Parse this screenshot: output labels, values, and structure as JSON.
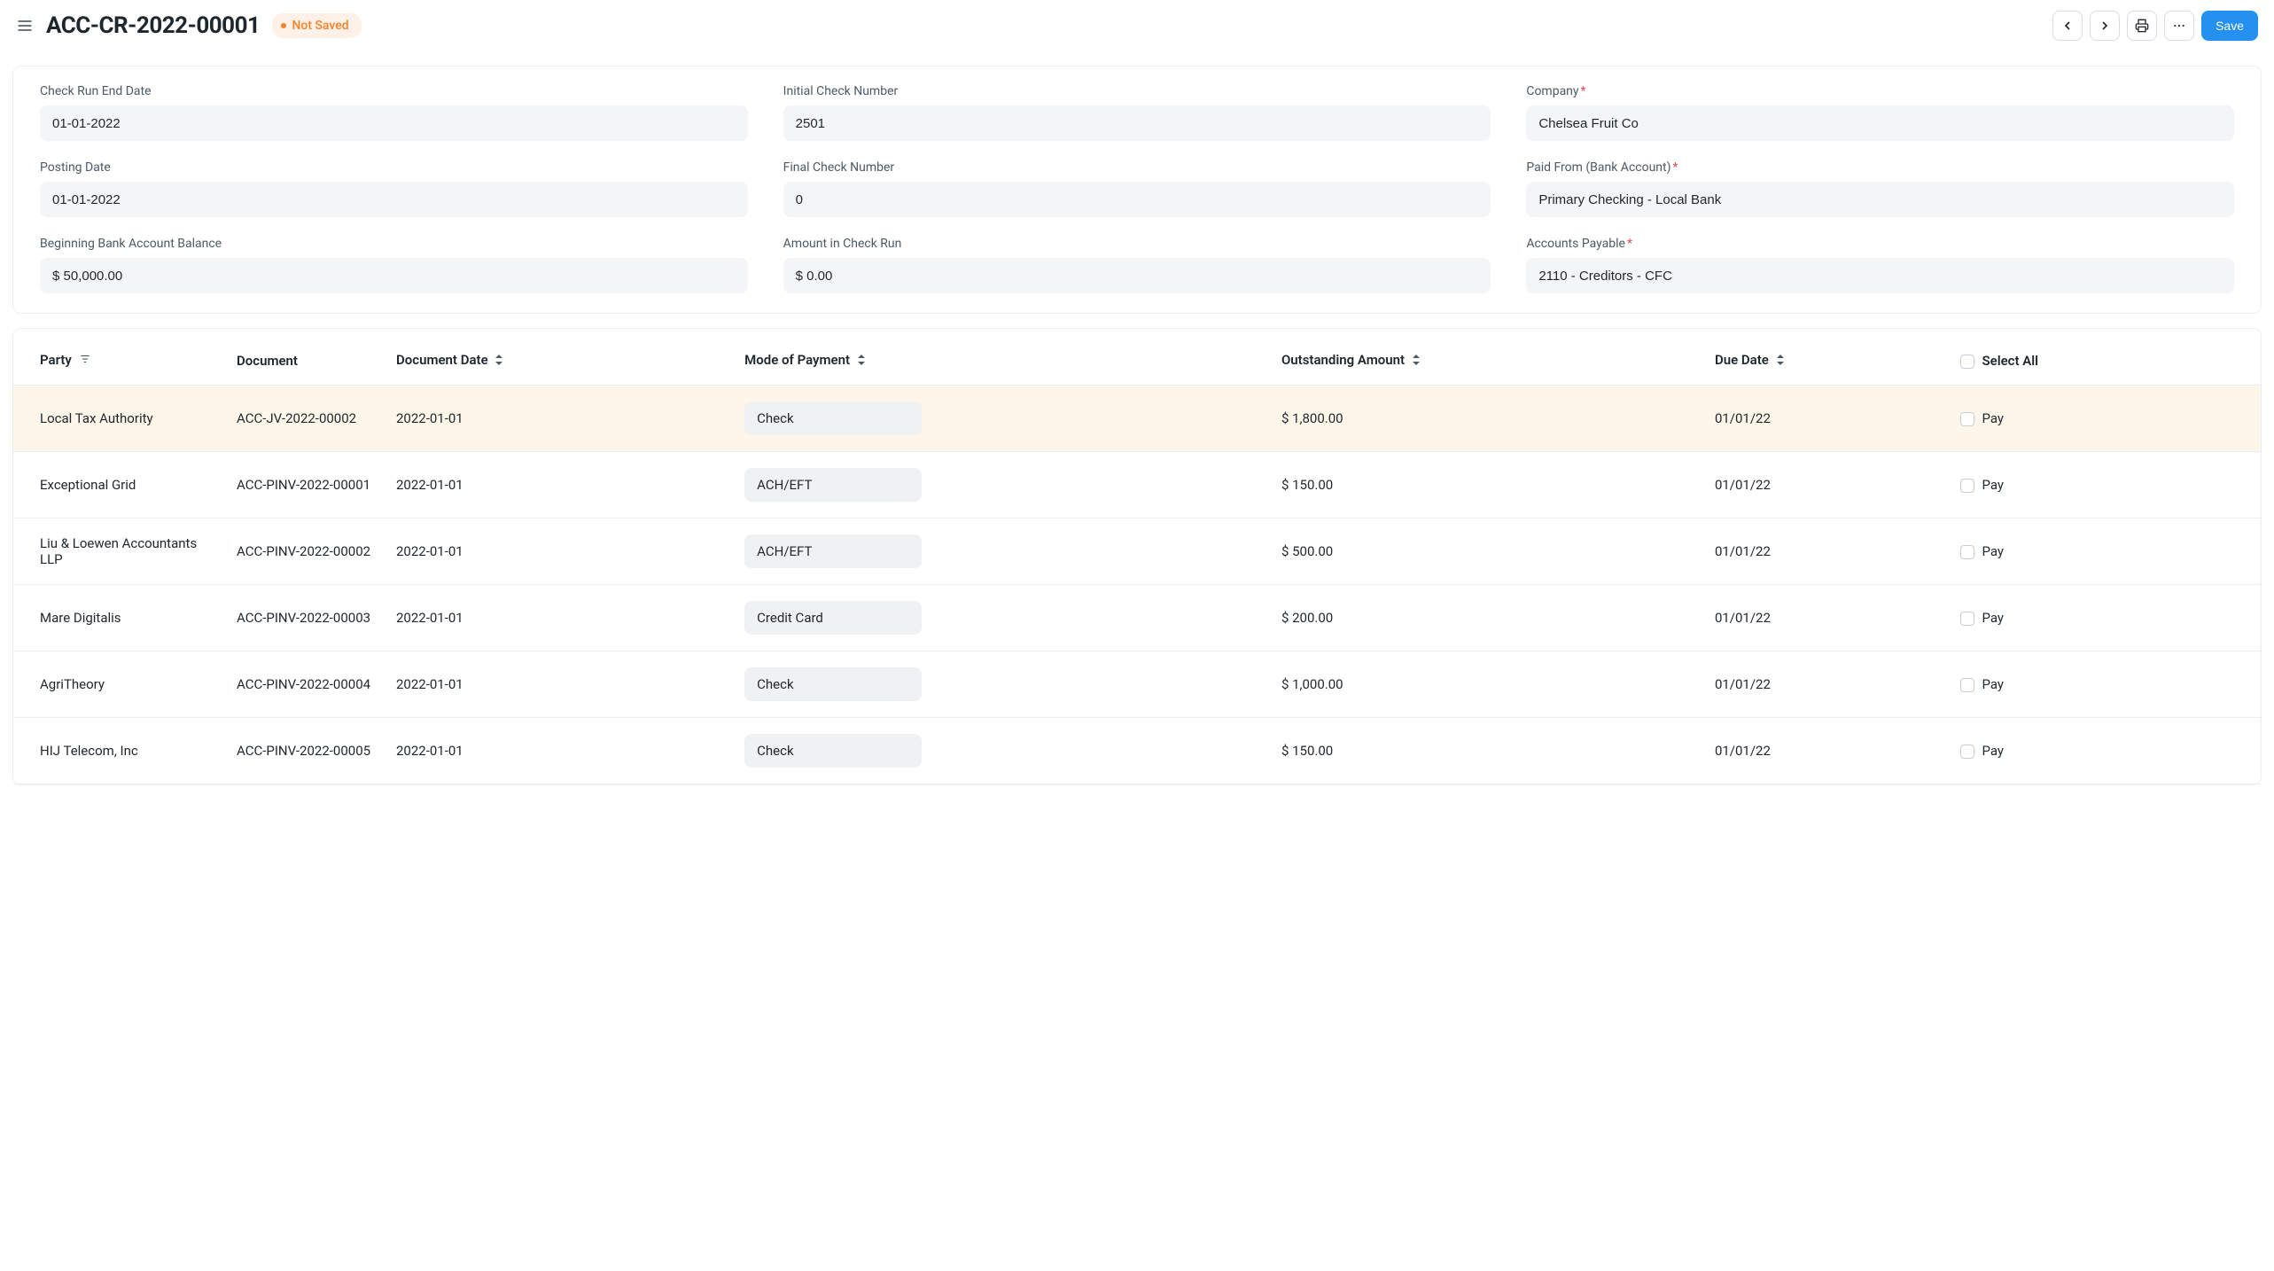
{
  "header": {
    "title": "ACC-CR-2022-00001",
    "status": "Not Saved",
    "save_label": "Save"
  },
  "form": {
    "check_run_end_date": {
      "label": "Check Run End Date",
      "value": "01-01-2022"
    },
    "initial_check_number": {
      "label": "Initial Check Number",
      "value": "2501"
    },
    "company": {
      "label": "Company",
      "value": "Chelsea Fruit Co",
      "required": true
    },
    "posting_date": {
      "label": "Posting Date",
      "value": "01-01-2022"
    },
    "final_check_number": {
      "label": "Final Check Number",
      "value": "0"
    },
    "paid_from": {
      "label": "Paid From (Bank Account)",
      "value": "Primary Checking - Local Bank",
      "required": true
    },
    "beginning_balance": {
      "label": "Beginning Bank Account Balance",
      "value": "$ 50,000.00"
    },
    "amount_in_run": {
      "label": "Amount in Check Run",
      "value": "$ 0.00"
    },
    "accounts_payable": {
      "label": "Accounts Payable",
      "value": "2110 - Creditors - CFC",
      "required": true
    }
  },
  "table": {
    "columns": {
      "party": "Party",
      "document": "Document",
      "document_date": "Document Date",
      "mode": "Mode of Payment",
      "outstanding": "Outstanding Amount",
      "due_date": "Due Date",
      "select_all": "Select All",
      "pay": "Pay"
    },
    "rows": [
      {
        "party": "Local Tax Authority",
        "document": "ACC-JV-2022-00002",
        "date": "2022-01-01",
        "mode": "Check",
        "amount": "$ 1,800.00",
        "due": "01/01/22",
        "highlight": true
      },
      {
        "party": "Exceptional Grid",
        "document": "ACC-PINV-2022-00001",
        "date": "2022-01-01",
        "mode": "ACH/EFT",
        "amount": "$ 150.00",
        "due": "01/01/22",
        "highlight": false
      },
      {
        "party": "Liu & Loewen Accountants LLP",
        "document": "ACC-PINV-2022-00002",
        "date": "2022-01-01",
        "mode": "ACH/EFT",
        "amount": "$ 500.00",
        "due": "01/01/22",
        "highlight": false
      },
      {
        "party": "Mare Digitalis",
        "document": "ACC-PINV-2022-00003",
        "date": "2022-01-01",
        "mode": "Credit Card",
        "amount": "$ 200.00",
        "due": "01/01/22",
        "highlight": false
      },
      {
        "party": "AgriTheory",
        "document": "ACC-PINV-2022-00004",
        "date": "2022-01-01",
        "mode": "Check",
        "amount": "$ 1,000.00",
        "due": "01/01/22",
        "highlight": false
      },
      {
        "party": "HIJ Telecom, Inc",
        "document": "ACC-PINV-2022-00005",
        "date": "2022-01-01",
        "mode": "Check",
        "amount": "$ 150.00",
        "due": "01/01/22",
        "highlight": false
      }
    ]
  }
}
